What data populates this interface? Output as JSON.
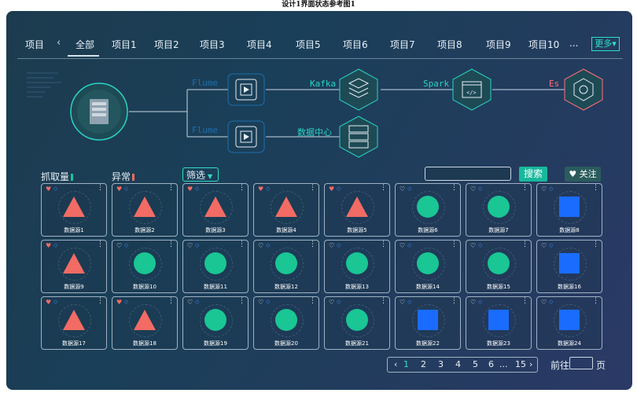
{
  "caption": "设计1界面状态参考图1",
  "nav": {
    "label": "项目",
    "back_icon": "chevron-left-icon",
    "tabs": [
      "全部",
      "项目1",
      "项目2",
      "项目3",
      "项目4",
      "项目5",
      "项目6",
      "项目7",
      "项目8",
      "项目9",
      "项目10"
    ],
    "active_tab": "全部",
    "ellipsis": "...",
    "more_label": "更多▾"
  },
  "diagram": {
    "labels": {
      "kafka": "Kafka",
      "spark": "Spark",
      "es": "Es",
      "data_center": "数据中心",
      "flume_top": "Flume",
      "flume_bottom": "Flume"
    },
    "colors": {
      "teal": "#2ad3c2",
      "red": "#ff6f7a",
      "faint": "#1c6fb0"
    }
  },
  "filters": {
    "capture_label": "抓取量",
    "anomaly_label": "异常",
    "select_value": "筛选",
    "search_button": "搜索",
    "follow_button": "♥ 关注",
    "search_placeholder": ""
  },
  "cards": [
    {
      "name": "数据源1",
      "shape": "triangle",
      "liked": true
    },
    {
      "name": "数据源2",
      "shape": "triangle",
      "liked": true
    },
    {
      "name": "数据源3",
      "shape": "triangle",
      "liked": true
    },
    {
      "name": "数据源4",
      "shape": "triangle",
      "liked": true
    },
    {
      "name": "数据源5",
      "shape": "triangle",
      "liked": true
    },
    {
      "name": "数据源6",
      "shape": "circle",
      "liked": false
    },
    {
      "name": "数据源7",
      "shape": "circle",
      "liked": false
    },
    {
      "name": "数据源8",
      "shape": "square",
      "liked": false
    },
    {
      "name": "数据源9",
      "shape": "triangle",
      "liked": true
    },
    {
      "name": "数据源10",
      "shape": "circle",
      "liked": false
    },
    {
      "name": "数据源11",
      "shape": "circle",
      "liked": false
    },
    {
      "name": "数据源12",
      "shape": "circle",
      "liked": false
    },
    {
      "name": "数据源13",
      "shape": "circle",
      "liked": false
    },
    {
      "name": "数据源14",
      "shape": "circle",
      "liked": false
    },
    {
      "name": "数据源15",
      "shape": "circle",
      "liked": false
    },
    {
      "name": "数据源16",
      "shape": "square",
      "liked": false
    },
    {
      "name": "数据源17",
      "shape": "triangle",
      "liked": true
    },
    {
      "name": "数据源18",
      "shape": "triangle",
      "liked": true
    },
    {
      "name": "数据源19",
      "shape": "circle",
      "liked": false
    },
    {
      "name": "数据源20",
      "shape": "circle",
      "liked": false
    },
    {
      "name": "数据源21",
      "shape": "circle",
      "liked": false
    },
    {
      "name": "数据源22",
      "shape": "square",
      "liked": false
    },
    {
      "name": "数据源23",
      "shape": "square",
      "liked": false
    },
    {
      "name": "数据源24",
      "shape": "square",
      "liked": false
    }
  ],
  "shape_colors": {
    "triangle": "#f26b64",
    "circle": "#19c694",
    "square": "#1a6cff"
  },
  "pagination": {
    "prev": "‹",
    "pages": [
      "1",
      "2",
      "3",
      "4",
      "5",
      "6"
    ],
    "current": "1",
    "ellipsis": "...",
    "last": "15",
    "next": "›",
    "goto_label": "前往",
    "goto_unit": "页"
  }
}
